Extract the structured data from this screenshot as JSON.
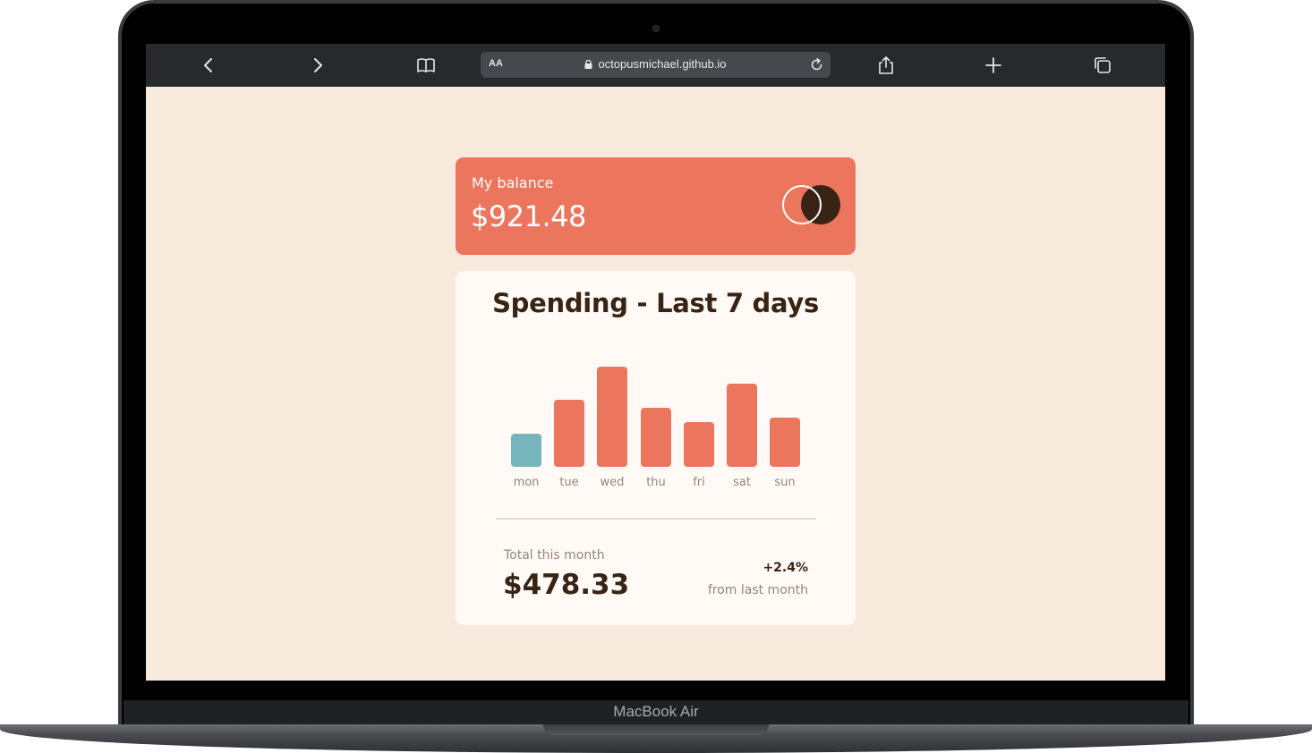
{
  "browser": {
    "url": "octopusmichael.github.io",
    "reader_label": "AA",
    "icons": [
      "back-icon",
      "forward-icon",
      "bookmarks-icon",
      "lock-icon",
      "reload-icon",
      "share-icon",
      "new-tab-icon",
      "tabs-icon"
    ]
  },
  "device": {
    "label": "MacBook Air"
  },
  "balance": {
    "label": "My balance",
    "amount": "$921.48"
  },
  "spending": {
    "title": "Spending - Last 7 days",
    "total_label": "Total this month",
    "total_amount": "$478.33",
    "change": "+2.4%",
    "change_label": "from last month"
  },
  "colors": {
    "accent": "#ec755d",
    "current_day": "#76b5bc",
    "background": "#f8e9dd",
    "card": "#fffaf5",
    "dark_text": "#382314",
    "muted_text": "#93867b"
  },
  "chart_data": {
    "type": "bar",
    "categories": [
      "mon",
      "tue",
      "wed",
      "thu",
      "fri",
      "sat",
      "sun"
    ],
    "values": [
      17.45,
      34.91,
      52.36,
      31.07,
      23.39,
      43.28,
      25.48
    ],
    "highlighted_category": "mon",
    "ylim": [
      0,
      52.36
    ]
  }
}
